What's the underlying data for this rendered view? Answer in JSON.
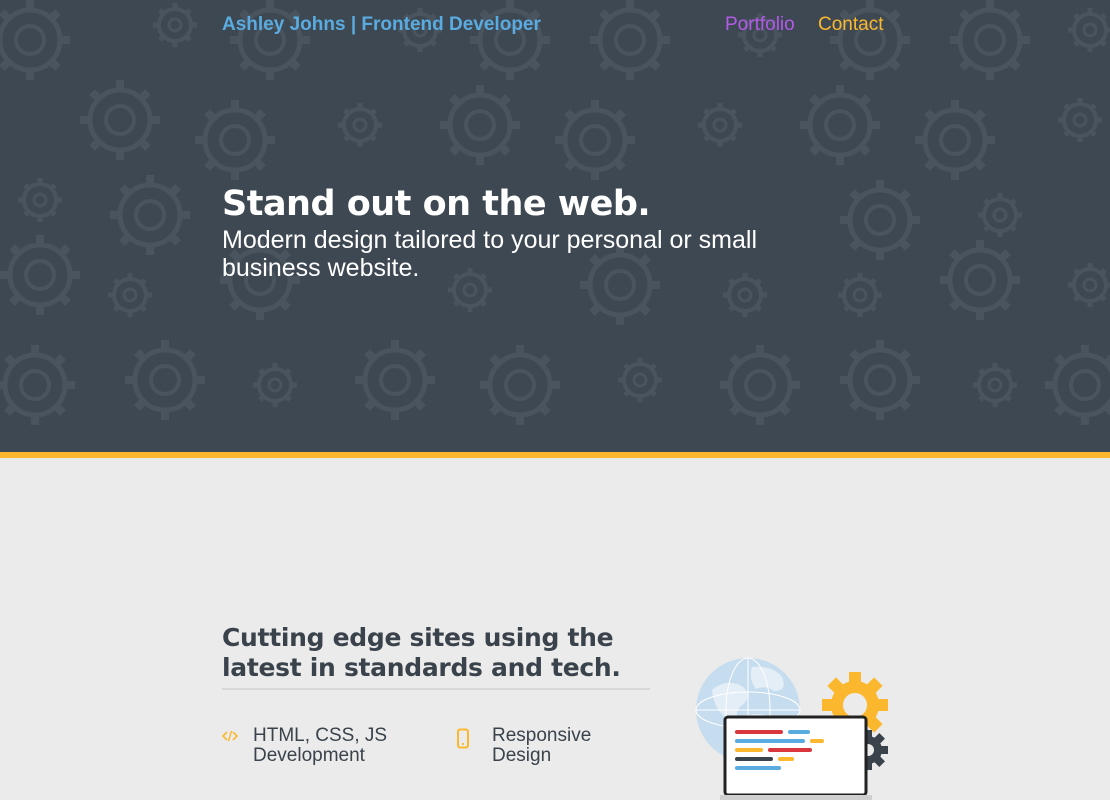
{
  "header": {
    "brand": "Ashley Johns | Frontend Developer",
    "nav": [
      {
        "label": "Portfolio",
        "color": "#b35ae8"
      },
      {
        "label": "Contact",
        "color": "#fbb82e"
      }
    ]
  },
  "hero": {
    "title": "Stand out on the web.",
    "subtitle": "Modern design tailored to your personal or small business website.",
    "background_color": "#3e4852",
    "pattern_icon": "gear-pattern"
  },
  "accent_color": "#fbb82e",
  "section": {
    "title": "Cutting edge sites using the latest in standards and tech.",
    "features": [
      {
        "icon": "code-icon",
        "label": "HTML, CSS, JS\nDevelopment"
      },
      {
        "icon": "mobile-icon",
        "label": "Responsive\nDesign"
      }
    ],
    "illustration_icons": [
      "globe-icon",
      "gear-icon",
      "laptop-code-icon"
    ]
  }
}
